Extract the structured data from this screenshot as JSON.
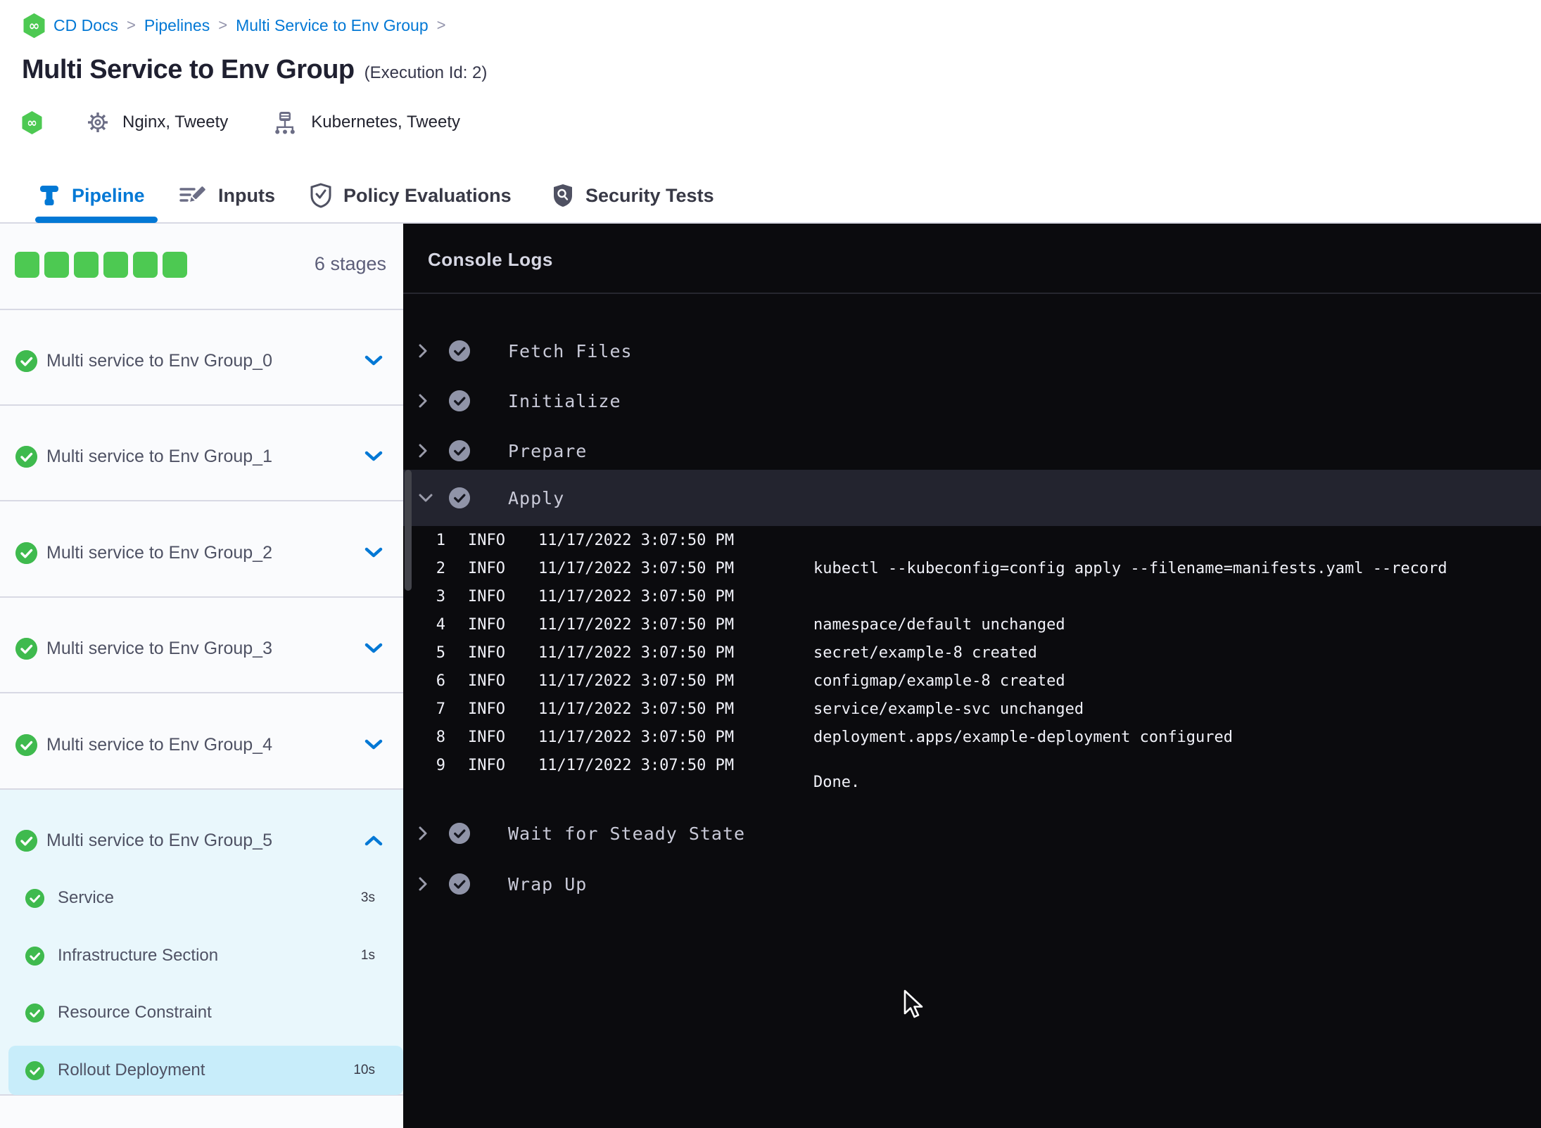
{
  "colors": {
    "accent_blue": "#0278d5",
    "success_green": "#4dc952",
    "console_bg": "#0b0b0e",
    "selected_step_bg": "#c8edfa",
    "expanded_stage_bg": "#e9f7fc"
  },
  "breadcrumb": {
    "items": [
      "CD Docs",
      "Pipelines",
      "Multi Service to Env Group"
    ],
    "separator": ">"
  },
  "header": {
    "title": "Multi Service to Env Group",
    "execution": "(Execution Id: 2)",
    "services": "Nginx, Tweety",
    "environments": "Kubernetes, Tweety"
  },
  "tabs": [
    {
      "label": "Pipeline"
    },
    {
      "label": "Inputs"
    },
    {
      "label": "Policy Evaluations"
    },
    {
      "label": "Security Tests"
    }
  ],
  "sidebar": {
    "stage_count": "6 stages",
    "stages": [
      {
        "label": "Multi service to Env Group_0"
      },
      {
        "label": "Multi service to Env Group_1"
      },
      {
        "label": "Multi service to Env Group_2"
      },
      {
        "label": "Multi service to Env Group_3"
      },
      {
        "label": "Multi service to Env Group_4"
      },
      {
        "label": "Multi service to Env Group_5"
      }
    ],
    "substeps": [
      {
        "label": "Service",
        "duration": "3s"
      },
      {
        "label": "Infrastructure Section",
        "duration": "1s"
      },
      {
        "label": "Resource Constraint",
        "duration": ""
      },
      {
        "label": "Rollout Deployment",
        "duration": "10s"
      }
    ]
  },
  "console": {
    "title": "Console Logs",
    "steps": {
      "fetch": "Fetch Files",
      "initialize": "Initialize",
      "prepare": "Prepare",
      "apply": "Apply",
      "wait": "Wait for Steady State",
      "wrapup": "Wrap Up"
    },
    "logs": [
      {
        "n": "1",
        "level": "INFO",
        "time": "11/17/2022 3:07:50 PM",
        "msg": ""
      },
      {
        "n": "2",
        "level": "INFO",
        "time": "11/17/2022 3:07:50 PM",
        "msg": "kubectl --kubeconfig=config apply --filename=manifests.yaml --record"
      },
      {
        "n": "3",
        "level": "INFO",
        "time": "11/17/2022 3:07:50 PM",
        "msg": ""
      },
      {
        "n": "4",
        "level": "INFO",
        "time": "11/17/2022 3:07:50 PM",
        "msg": "namespace/default unchanged"
      },
      {
        "n": "5",
        "level": "INFO",
        "time": "11/17/2022 3:07:50 PM",
        "msg": "secret/example-8 created"
      },
      {
        "n": "6",
        "level": "INFO",
        "time": "11/17/2022 3:07:50 PM",
        "msg": "configmap/example-8 created"
      },
      {
        "n": "7",
        "level": "INFO",
        "time": "11/17/2022 3:07:50 PM",
        "msg": "service/example-svc unchanged"
      },
      {
        "n": "8",
        "level": "INFO",
        "time": "11/17/2022 3:07:50 PM",
        "msg": "deployment.apps/example-deployment configured"
      },
      {
        "n": "9",
        "level": "INFO",
        "time": "11/17/2022 3:07:50 PM",
        "msg": ""
      }
    ],
    "done": "Done."
  }
}
